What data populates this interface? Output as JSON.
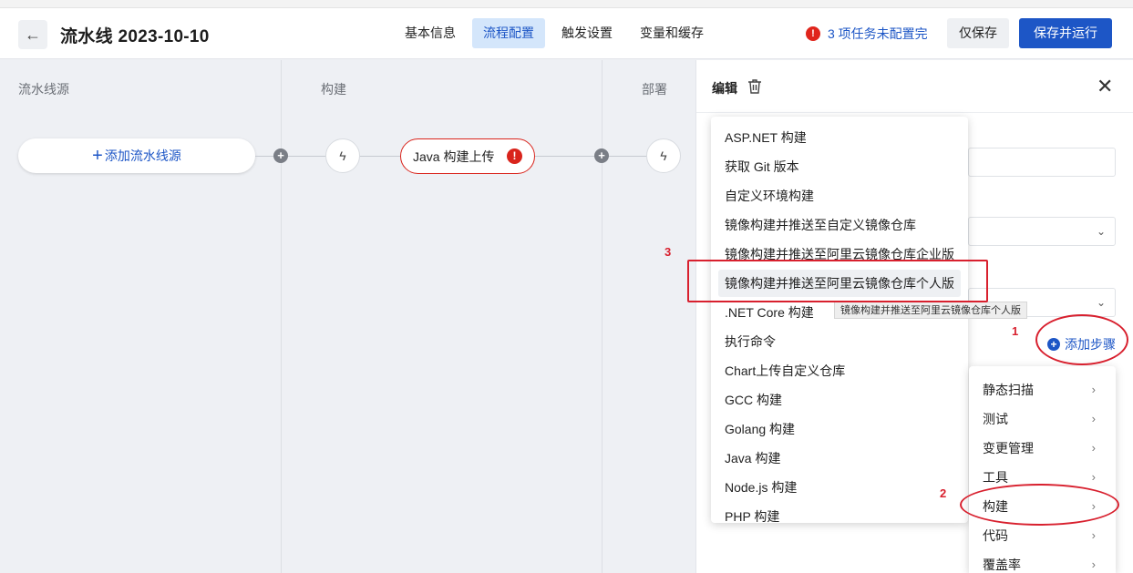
{
  "header": {
    "back_icon": "arrow-left-icon",
    "title": "流水线 2023-10-10",
    "tabs": [
      {
        "label": "基本信息",
        "active": false
      },
      {
        "label": "流程配置",
        "active": true
      },
      {
        "label": "触发设置",
        "active": false
      },
      {
        "label": "变量和缓存",
        "active": false
      }
    ],
    "warning_text": "3 项任务未配置完",
    "warning_icon": "!",
    "save_only_label": "仅保存",
    "save_run_label": "保存并运行"
  },
  "canvas": {
    "stages": [
      "流水线源",
      "构建",
      "部署"
    ],
    "add_source_label": "添加流水线源",
    "add_source_plus": "+",
    "job_label": "Java 构建上传",
    "job_error_icon": "!",
    "plus_symbol": "+",
    "bolt_symbol": "ϟ"
  },
  "panel": {
    "title": "编辑",
    "close_symbol": "✕",
    "add_step_label": "添加步骤",
    "add_step_plus": "+"
  },
  "menu_left": {
    "items": [
      "ASP.NET 构建",
      "获取 Git 版本",
      "自定义环境构建",
      "镜像构建并推送至自定义镜像仓库",
      "镜像构建并推送至阿里云镜像仓库企业版",
      "镜像构建并推送至阿里云镜像仓库个人版",
      ".NET Core 构建",
      "执行命令",
      "Chart上传自定义仓库",
      "GCC 构建",
      "Golang 构建",
      "Java 构建",
      "Node.js 构建",
      "PHP 构建"
    ],
    "highlighted_index": 5
  },
  "tooltip": "镜像构建并推送至阿里云镜像仓库个人版",
  "menu_right": {
    "items": [
      "静态扫描",
      "测试",
      "变更管理",
      "工具",
      "构建",
      "代码",
      "覆盖率"
    ],
    "arrow": "›"
  },
  "annotations": {
    "one": "1",
    "two": "2",
    "three": "3"
  },
  "colors": {
    "accent": "#1d56c6",
    "error": "#d9241c",
    "annotation": "#d8202e"
  }
}
